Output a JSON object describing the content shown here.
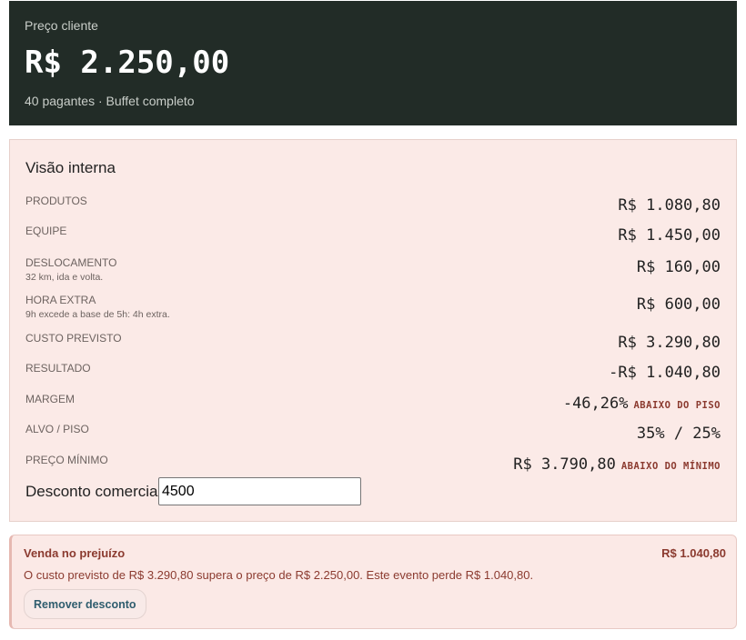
{
  "header": {
    "label": "Preço cliente",
    "price": "R$ 2.250,00",
    "subtitle": "40 pagantes · Buffet completo"
  },
  "internal": {
    "title": "Visão interna",
    "rows": [
      {
        "key": "PRODUTOS",
        "value": "R$ 1.080,80"
      },
      {
        "key": "EQUIPE",
        "value": "R$ 1.450,00"
      },
      {
        "key": "DESLOCAMENTO",
        "note": "32 km, ida e volta.",
        "value": "R$ 160,00"
      },
      {
        "key": "HORA EXTRA",
        "note": "9h excede a base de 5h: 4h extra.",
        "value": "R$ 600,00"
      },
      {
        "key": "CUSTO PREVISTO",
        "value": "R$ 3.290,80"
      },
      {
        "key": "RESULTADO",
        "value": "-R$ 1.040,80"
      },
      {
        "key": "MARGEM",
        "value": "-46,26%",
        "tag": "ABAIXO DO PISO"
      },
      {
        "key": "ALVO / PISO",
        "value": "35% / 25%"
      },
      {
        "key": "PREÇO MÍNIMO",
        "value": "R$ 3.790,80",
        "tag": "ABAIXO DO MÍNIMO"
      }
    ],
    "discount": {
      "label": "Desconto comercial",
      "value": "4500"
    }
  },
  "alert": {
    "title": "Venda no prejuízo",
    "amount": "R$ 1.040,80",
    "message": "O custo previsto de R$ 3.290,80 supera o preço de R$ 2.250,00. Este evento perde R$ 1.040,80.",
    "button_label": "Remover desconto"
  },
  "colors": {
    "header_bg": "#222c27",
    "panel_bg": "#fbeae7",
    "alert_text": "#8b3a2f",
    "button_text": "#2f5d6e"
  }
}
